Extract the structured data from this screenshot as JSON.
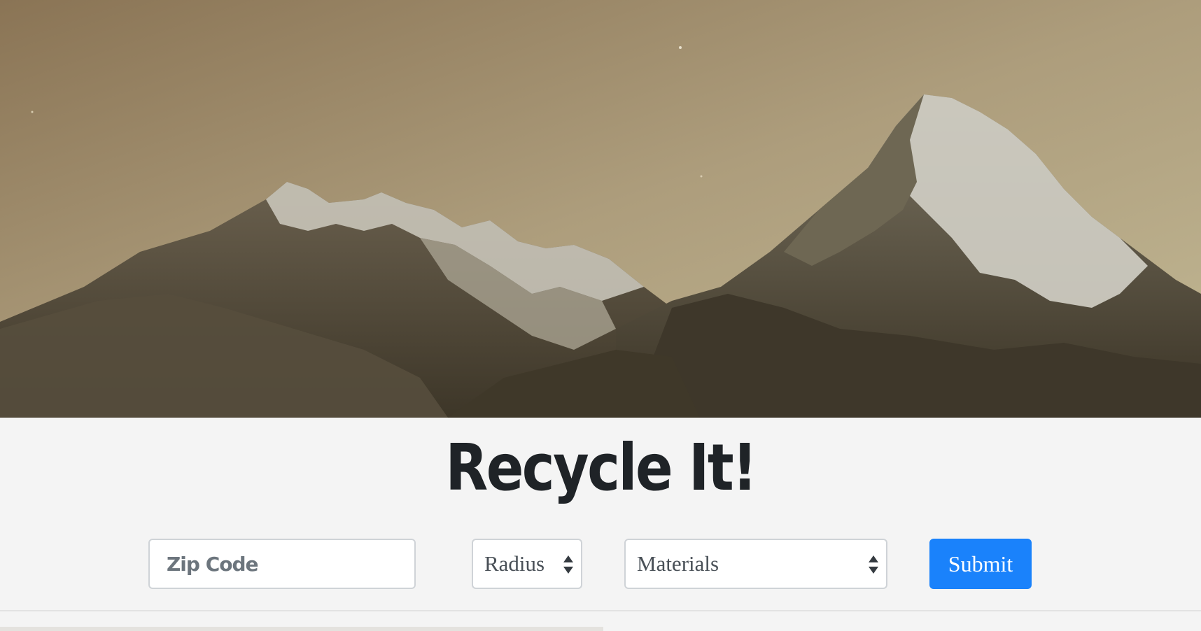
{
  "header": {
    "title": "Recycle It!"
  },
  "search_form": {
    "zip_placeholder": "Zip Code",
    "radius_label": "Radius",
    "materials_label": "Materials",
    "submit_label": "Submit"
  },
  "colors": {
    "primary": "#1a82fb",
    "title_text": "#1f2327",
    "page_background": "#f4f4f4",
    "hero_sky": "#b3a584"
  }
}
